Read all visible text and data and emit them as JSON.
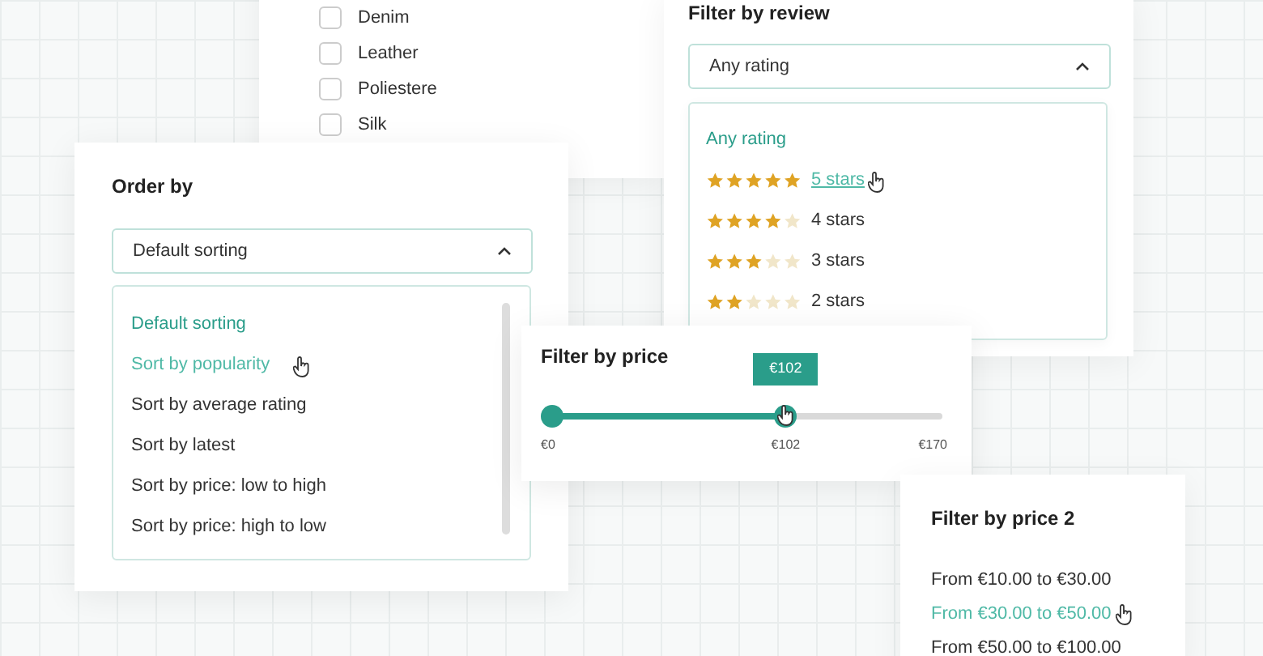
{
  "material": {
    "options": [
      {
        "label": "Denim",
        "checked": false
      },
      {
        "label": "Leather",
        "checked": false
      },
      {
        "label": "Poliestere",
        "checked": false
      },
      {
        "label": "Silk",
        "checked": false
      }
    ]
  },
  "review": {
    "title": "Filter by review",
    "value": "Any rating",
    "expanded": true,
    "options": [
      {
        "kind": "text",
        "label": "Any rating",
        "selected": true,
        "hovered": false
      },
      {
        "kind": "stars",
        "label": "5 stars",
        "stars": 5,
        "selected": false,
        "hovered": true
      },
      {
        "kind": "stars",
        "label": "4 stars",
        "stars": 4,
        "selected": false,
        "hovered": false
      },
      {
        "kind": "stars",
        "label": "3 stars",
        "stars": 3,
        "selected": false,
        "hovered": false
      },
      {
        "kind": "stars",
        "label": "2 stars",
        "stars": 2,
        "selected": false,
        "hovered": false
      }
    ]
  },
  "order": {
    "title": "Order by",
    "value": "Default sorting",
    "expanded": true,
    "options": [
      {
        "label": "Default sorting",
        "selected": true,
        "hovered": false
      },
      {
        "label": "Sort by popularity",
        "selected": false,
        "hovered": true
      },
      {
        "label": "Sort by average rating",
        "selected": false,
        "hovered": false
      },
      {
        "label": "Sort by latest",
        "selected": false,
        "hovered": false
      },
      {
        "label": "Sort by price: low to high",
        "selected": false,
        "hovered": false
      },
      {
        "label": "Sort by price: high to low",
        "selected": false,
        "hovered": false
      }
    ]
  },
  "price": {
    "title": "Filter by price",
    "tooltip": "€102",
    "level": 0.6,
    "min_label": "€0",
    "value_label": "€102",
    "max_label": "€170"
  },
  "price2": {
    "title": "Filter by price 2",
    "options": [
      {
        "label": "From €10.00 to €30.00",
        "hovered": false
      },
      {
        "label": "From €30.00 to €50.00",
        "hovered": true
      },
      {
        "label": "From €50.00 to €100.00",
        "hovered": false
      }
    ]
  }
}
